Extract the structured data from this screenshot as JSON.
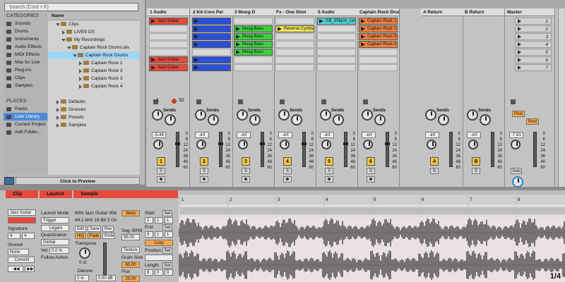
{
  "browser": {
    "search_placeholder": "Search (Cmd + F)",
    "categories_title": "CATEGORIES",
    "categories": [
      "Sounds",
      "Drums",
      "Instruments",
      "Audio Effects",
      "MIDI Effects",
      "Max for Live",
      "Plug-ins",
      "Clips",
      "Samples"
    ],
    "places_title": "PLACES",
    "places": [
      "Packs",
      "User Library",
      "Current Project",
      "Add Folder..."
    ],
    "selected_place": "User Library",
    "name_header": "Name",
    "files": [
      {
        "label": "Clips",
        "indent": 1,
        "open": true
      },
      {
        "label": "LIVE9 GS",
        "indent": 2,
        "open": false
      },
      {
        "label": "My Recordings",
        "indent": 2,
        "open": true
      },
      {
        "label": "Captain Rock Drums.als",
        "indent": 3,
        "open": true
      },
      {
        "label": "Captain Rock Drums",
        "indent": 4,
        "open": true,
        "selected": true
      },
      {
        "label": "Captain Rock 1",
        "indent": 5,
        "open": false
      },
      {
        "label": "Captain Rock 2",
        "indent": 5,
        "open": false
      },
      {
        "label": "Captain Rock 3",
        "indent": 5,
        "open": false
      },
      {
        "label": "Captain Rock 4",
        "indent": 5,
        "open": false
      },
      {
        "label": "",
        "indent": 0,
        "open": false
      },
      {
        "label": "Defaults",
        "indent": 1,
        "open": false
      },
      {
        "label": "Grooves",
        "indent": 1,
        "open": false
      },
      {
        "label": "Presets",
        "indent": 1,
        "open": false
      },
      {
        "label": "Samples",
        "indent": 1,
        "open": false
      }
    ],
    "preview_label": "Click to Preview"
  },
  "tracks": [
    {
      "name": "1 Audio",
      "color": "#e84a3a",
      "clips": [
        "Jazz Guitar",
        "",
        "",
        "",
        "",
        "Jazz Guitar",
        "Jazz Guitar"
      ],
      "num": "1",
      "vol": "-5.48"
    },
    {
      "name": "2 Kit-Core Per",
      "color": "#2a4fd8",
      "clips": [
        "blue",
        "blue",
        "blue",
        "blue",
        "",
        "blue",
        "blue"
      ],
      "num": "2",
      "vol": "-inf"
    },
    {
      "name": "3 Moog D",
      "color": "#3fcf3f",
      "clips": [
        "",
        "Moog Bass",
        "Moog Bass",
        "Moog Bass",
        "Moog Bass",
        "",
        ""
      ],
      "num": "3",
      "vol": "-inf"
    },
    {
      "name": "Fx - One Shot",
      "color": "#f0e35a",
      "clips": [
        "",
        "Reverse Cymbal",
        "",
        "",
        "",
        "",
        ""
      ],
      "num": "4",
      "vol": "-inf"
    },
    {
      "name": "5 Audio",
      "color": "#4fd2d8",
      "clips": [
        "GB_85bpm_com",
        "",
        "",
        "",
        "",
        "",
        ""
      ],
      "num": "5",
      "vol": "-inf"
    },
    {
      "name": "Captain Rock Drums",
      "color": "#f0803c",
      "clips": [
        "Captain Rock 1",
        "Captain Rock 2",
        "Captain Rock 3",
        "Captain Rock 4",
        "",
        "",
        ""
      ],
      "num": "6",
      "vol": "-inf"
    }
  ],
  "returns": [
    {
      "name": "A Return",
      "num": "A",
      "vol": "-inf"
    },
    {
      "name": "B Return",
      "num": "B",
      "vol": "-inf"
    }
  ],
  "master": {
    "name": "Master",
    "scenes": [
      "1",
      "2",
      "3",
      "4",
      "5",
      "6",
      "7"
    ],
    "vol": "-7.91",
    "post1": "Post",
    "post2": "Post",
    "solo": "Solo"
  },
  "tempo_row": {
    "left": "1",
    "right": "32"
  },
  "sends_label": "Sends",
  "meter_scale": [
    "0",
    "6",
    "12",
    "24",
    "36",
    "48",
    "60"
  ],
  "solo_label": "S",
  "detail": {
    "clip_title": "Clip",
    "clip_name": "Jazz Guitar",
    "signature_label": "Signature",
    "sig_num": "4",
    "sig_den": "4",
    "groove_label": "Groove",
    "groove_value": "None",
    "commit_label": "Commit",
    "launch_title": "Launch",
    "launch_mode_label": "Launch Mode",
    "launch_mode_value": "Trigger",
    "legato_label": "Legato",
    "quantization_label": "Quantization",
    "quantization_value": "Global",
    "vel_label": "Vel",
    "vel_value": "0.0 %",
    "follow_label": "Follow Action",
    "sample_title": "Sample",
    "sample_file": "80N Jazz Guitar 95b",
    "warp_label": "Warp",
    "sample_info": "44.1 kHz 16 Bit 2 Ch",
    "edit_label": "Edit",
    "save_label": "Save",
    "rev_label": "Rev",
    "hiq_label": "HiQ",
    "fade_label": "Fade",
    "ram_label": "RAM",
    "seg_bpm_label": "Seg. BPM",
    "seg_bpm_value": "95.00",
    "transpose_label": "Transpose",
    "transpose_value": "0 st",
    "detune_label": "Detune",
    "detune_value": "0 ct",
    "vol_value": "0.00 dB",
    "texture_value": "Texture",
    "grain_label": "Grain Size",
    "grain_value": "65.00",
    "flux_label": "Flux",
    "flux_value": "25.00",
    "start_label": "Start",
    "start_vals": [
      "1",
      "1",
      "1"
    ],
    "end_label": "End",
    "end_vals": [
      "9",
      "1",
      "1"
    ],
    "loop_label": "Loop",
    "position_label": "Position",
    "length_label": "Length",
    "length_vals": [
      "8",
      "0",
      "0"
    ],
    "set_label": "Set",
    "ruler": [
      "1",
      "2",
      "3",
      "4",
      "5",
      "6",
      "7",
      "8"
    ],
    "zoom": "1/4"
  },
  "colors": {
    "accent": "#e84a3a",
    "launch_btn": "#f6c543",
    "selection": "#4f8bd6"
  }
}
